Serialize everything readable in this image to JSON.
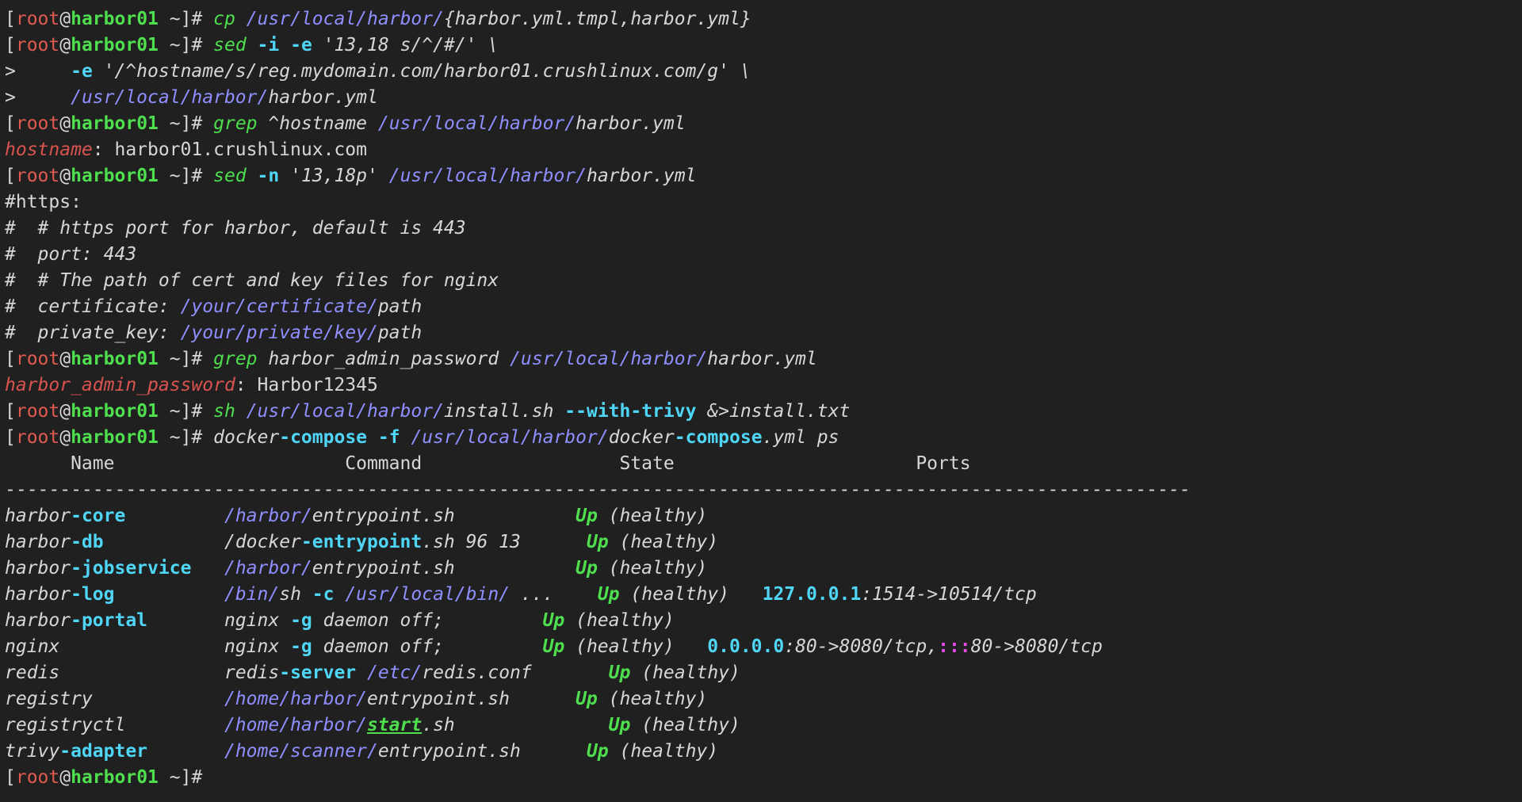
{
  "colors": {
    "background": "#202020",
    "text": "#d7d7d7",
    "red": "#e05a4f",
    "key": "#d9534f",
    "green": "#4ede4e",
    "blue": "#8f8fff",
    "cyan": "#4fd6f7",
    "magenta": "#e64ae6"
  },
  "lines": [
    [
      [
        "[",
        "text"
      ],
      [
        "root",
        "red"
      ],
      [
        "@",
        "text"
      ],
      [
        "harbor01",
        "green",
        1
      ],
      [
        " ~]# ",
        "text"
      ],
      [
        "cp",
        "green",
        0,
        1
      ],
      [
        " ",
        "text"
      ],
      [
        "/usr/local/harbor/",
        "blue",
        0,
        1
      ],
      [
        "{harbor.yml.tmpl,harbor.yml}",
        "text",
        0,
        1
      ]
    ],
    [
      [
        "[",
        "text"
      ],
      [
        "root",
        "red"
      ],
      [
        "@",
        "text"
      ],
      [
        "harbor01",
        "green",
        1
      ],
      [
        " ~]# ",
        "text"
      ],
      [
        "sed",
        "green",
        0,
        1
      ],
      [
        " ",
        "text"
      ],
      [
        "-i",
        "cyan",
        1
      ],
      [
        " ",
        "text"
      ],
      [
        "-e",
        "cyan",
        1
      ],
      [
        " '13,18 s/^/#/' \\",
        "text",
        0,
        1
      ]
    ],
    [
      [
        ">     ",
        "text"
      ],
      [
        "-e",
        "cyan",
        1
      ],
      [
        " '/^hostname/s/reg.mydomain.com/harbor01.crushlinux.com/g' \\",
        "text",
        0,
        1
      ]
    ],
    [
      [
        ">     ",
        "text"
      ],
      [
        "/usr/local/harbor/",
        "blue",
        0,
        1
      ],
      [
        "harbor.yml",
        "text",
        0,
        1
      ]
    ],
    [
      [
        "[",
        "text"
      ],
      [
        "root",
        "red"
      ],
      [
        "@",
        "text"
      ],
      [
        "harbor01",
        "green",
        1
      ],
      [
        " ~]# ",
        "text"
      ],
      [
        "grep",
        "green",
        0,
        1
      ],
      [
        " ^hostname ",
        "text",
        0,
        1
      ],
      [
        "/usr/local/harbor/",
        "blue",
        0,
        1
      ],
      [
        "harbor.yml",
        "text",
        0,
        1
      ]
    ],
    [
      [
        "hostname",
        "key",
        0,
        1
      ],
      [
        ": harbor01.crushlinux.com",
        "text"
      ]
    ],
    [
      [
        "[",
        "text"
      ],
      [
        "root",
        "red"
      ],
      [
        "@",
        "text"
      ],
      [
        "harbor01",
        "green",
        1
      ],
      [
        " ~]# ",
        "text"
      ],
      [
        "sed",
        "green",
        0,
        1
      ],
      [
        " ",
        "text"
      ],
      [
        "-n",
        "cyan",
        1
      ],
      [
        " '13,18p' ",
        "text",
        0,
        1
      ],
      [
        "/usr/local/harbor/",
        "blue",
        0,
        1
      ],
      [
        "harbor.yml",
        "text",
        0,
        1
      ]
    ],
    [
      [
        "#https:",
        "text"
      ]
    ],
    [
      [
        "#  # https port for harbor, default is 443",
        "text",
        0,
        1
      ]
    ],
    [
      [
        "#  port: 443",
        "text",
        0,
        1
      ]
    ],
    [
      [
        "#  # The path of cert and key files for nginx",
        "text",
        0,
        1
      ]
    ],
    [
      [
        "#  certificate: ",
        "text",
        0,
        1
      ],
      [
        "/your/certificate/",
        "blue",
        0,
        1
      ],
      [
        "path",
        "text",
        0,
        1
      ]
    ],
    [
      [
        "#  private_key: ",
        "text",
        0,
        1
      ],
      [
        "/your/private/key/",
        "blue",
        0,
        1
      ],
      [
        "path",
        "text",
        0,
        1
      ]
    ],
    [
      [
        "[",
        "text"
      ],
      [
        "root",
        "red"
      ],
      [
        "@",
        "text"
      ],
      [
        "harbor01",
        "green",
        1
      ],
      [
        " ~]# ",
        "text"
      ],
      [
        "grep",
        "green",
        0,
        1
      ],
      [
        " harbor_admin_password ",
        "text",
        0,
        1
      ],
      [
        "/usr/local/harbor/",
        "blue",
        0,
        1
      ],
      [
        "harbor.yml",
        "text",
        0,
        1
      ]
    ],
    [
      [
        "harbor_admin_password",
        "key",
        0,
        1
      ],
      [
        ": Harbor12345",
        "text"
      ]
    ],
    [
      [
        "[",
        "text"
      ],
      [
        "root",
        "red"
      ],
      [
        "@",
        "text"
      ],
      [
        "harbor01",
        "green",
        1
      ],
      [
        " ~]# ",
        "text"
      ],
      [
        "sh",
        "green",
        0,
        1
      ],
      [
        " ",
        "text"
      ],
      [
        "/usr/local/harbor/",
        "blue",
        0,
        1
      ],
      [
        "install.sh ",
        "text",
        0,
        1
      ],
      [
        "--with-trivy",
        "cyan",
        1
      ],
      [
        " &>install.txt",
        "text",
        0,
        1
      ]
    ],
    [
      [
        "[",
        "text"
      ],
      [
        "root",
        "red"
      ],
      [
        "@",
        "text"
      ],
      [
        "harbor01",
        "green",
        1
      ],
      [
        " ~]# ",
        "text"
      ],
      [
        "docker",
        "text",
        0,
        1
      ],
      [
        "-compose",
        "cyan",
        1
      ],
      [
        " ",
        "text"
      ],
      [
        "-f",
        "cyan",
        1
      ],
      [
        " ",
        "text"
      ],
      [
        "/usr/local/harbor/",
        "blue",
        0,
        1
      ],
      [
        "docker",
        "text",
        0,
        1
      ],
      [
        "-compose",
        "cyan",
        1
      ],
      [
        ".yml ps",
        "text",
        0,
        1
      ]
    ],
    [
      [
        "      Name                     Command                  State                      Ports",
        "text"
      ]
    ],
    [
      [
        "------------------------------------------------------------------------------------------------------------",
        "text"
      ]
    ],
    [
      [
        "harbor",
        "text",
        0,
        1
      ],
      [
        "-core",
        "cyan",
        1
      ],
      [
        "         ",
        "text"
      ],
      [
        "/harbor/",
        "blue",
        0,
        1
      ],
      [
        "entrypoint.sh",
        "text",
        0,
        1
      ],
      [
        "           ",
        "text"
      ],
      [
        "Up",
        "green",
        1,
        1
      ],
      [
        " (healthy)",
        "text",
        0,
        1
      ]
    ],
    [
      [
        "harbor",
        "text",
        0,
        1
      ],
      [
        "-db",
        "cyan",
        1
      ],
      [
        "           ",
        "text"
      ],
      [
        "/docker",
        "text",
        0,
        1
      ],
      [
        "-entrypoint",
        "cyan",
        1
      ],
      [
        ".sh 96 13",
        "text",
        0,
        1
      ],
      [
        "      ",
        "text"
      ],
      [
        "Up",
        "green",
        1,
        1
      ],
      [
        " (healthy)",
        "text",
        0,
        1
      ]
    ],
    [
      [
        "harbor",
        "text",
        0,
        1
      ],
      [
        "-jobservice",
        "cyan",
        1
      ],
      [
        "   ",
        "text"
      ],
      [
        "/harbor/",
        "blue",
        0,
        1
      ],
      [
        "entrypoint.sh",
        "text",
        0,
        1
      ],
      [
        "           ",
        "text"
      ],
      [
        "Up",
        "green",
        1,
        1
      ],
      [
        " (healthy)",
        "text",
        0,
        1
      ]
    ],
    [
      [
        "harbor",
        "text",
        0,
        1
      ],
      [
        "-log",
        "cyan",
        1
      ],
      [
        "          ",
        "text"
      ],
      [
        "/bin/",
        "blue",
        0,
        1
      ],
      [
        "sh ",
        "text",
        0,
        1
      ],
      [
        "-c",
        "cyan",
        1
      ],
      [
        " ",
        "text"
      ],
      [
        "/usr/local/bin/",
        "blue",
        0,
        1
      ],
      [
        " ...",
        "text",
        0,
        1
      ],
      [
        "    ",
        "text"
      ],
      [
        "Up",
        "green",
        1,
        1
      ],
      [
        " (healthy)",
        "text",
        0,
        1
      ],
      [
        "   ",
        "text"
      ],
      [
        "127.0.0.1",
        "cyan",
        1
      ],
      [
        ":1514->10514/tcp",
        "text",
        0,
        1
      ]
    ],
    [
      [
        "harbor",
        "text",
        0,
        1
      ],
      [
        "-portal",
        "cyan",
        1
      ],
      [
        "       ",
        "text"
      ],
      [
        "nginx ",
        "text",
        0,
        1
      ],
      [
        "-g",
        "cyan",
        1
      ],
      [
        " daemon off;",
        "text",
        0,
        1
      ],
      [
        "         ",
        "text"
      ],
      [
        "Up",
        "green",
        1,
        1
      ],
      [
        " (healthy)",
        "text",
        0,
        1
      ]
    ],
    [
      [
        "nginx",
        "text",
        0,
        1
      ],
      [
        "               ",
        "text"
      ],
      [
        "nginx ",
        "text",
        0,
        1
      ],
      [
        "-g",
        "cyan",
        1
      ],
      [
        " daemon off;",
        "text",
        0,
        1
      ],
      [
        "         ",
        "text"
      ],
      [
        "Up",
        "green",
        1,
        1
      ],
      [
        " (healthy)",
        "text",
        0,
        1
      ],
      [
        "   ",
        "text"
      ],
      [
        "0.0.0.0",
        "cyan",
        1
      ],
      [
        ":80->8080/tcp,",
        "text",
        0,
        1
      ],
      [
        ":::",
        "magenta",
        1
      ],
      [
        "80->8080/tcp",
        "text",
        0,
        1
      ]
    ],
    [
      [
        "redis",
        "text",
        0,
        1
      ],
      [
        "               ",
        "text"
      ],
      [
        "redis",
        "text",
        0,
        1
      ],
      [
        "-server",
        "cyan",
        1
      ],
      [
        " ",
        "text"
      ],
      [
        "/etc/",
        "blue",
        0,
        1
      ],
      [
        "redis.conf",
        "text",
        0,
        1
      ],
      [
        "       ",
        "text"
      ],
      [
        "Up",
        "green",
        1,
        1
      ],
      [
        " (healthy)",
        "text",
        0,
        1
      ]
    ],
    [
      [
        "registry",
        "text",
        0,
        1
      ],
      [
        "            ",
        "text"
      ],
      [
        "/home/harbor/",
        "blue",
        0,
        1
      ],
      [
        "entrypoint.sh",
        "text",
        0,
        1
      ],
      [
        "      ",
        "text"
      ],
      [
        "Up",
        "green",
        1,
        1
      ],
      [
        " (healthy)",
        "text",
        0,
        1
      ]
    ],
    [
      [
        "registryctl",
        "text",
        0,
        1
      ],
      [
        "         ",
        "text"
      ],
      [
        "/home/harbor/",
        "blue",
        0,
        1
      ],
      [
        "start",
        "green",
        1,
        1,
        1
      ],
      [
        ".sh",
        "text",
        0,
        1
      ],
      [
        "              ",
        "text"
      ],
      [
        "Up",
        "green",
        1,
        1
      ],
      [
        " (healthy)",
        "text",
        0,
        1
      ]
    ],
    [
      [
        "trivy",
        "text",
        0,
        1
      ],
      [
        "-adapter",
        "cyan",
        1
      ],
      [
        "       ",
        "text"
      ],
      [
        "/home/scanner/",
        "blue",
        0,
        1
      ],
      [
        "entrypoint.sh",
        "text",
        0,
        1
      ],
      [
        "      ",
        "text"
      ],
      [
        "Up",
        "green",
        1,
        1
      ],
      [
        " (healthy)",
        "text",
        0,
        1
      ]
    ],
    [
      [
        "[",
        "text"
      ],
      [
        "root",
        "red"
      ],
      [
        "@",
        "text"
      ],
      [
        "harbor01",
        "green",
        1
      ],
      [
        " ~]#",
        "text"
      ]
    ]
  ]
}
